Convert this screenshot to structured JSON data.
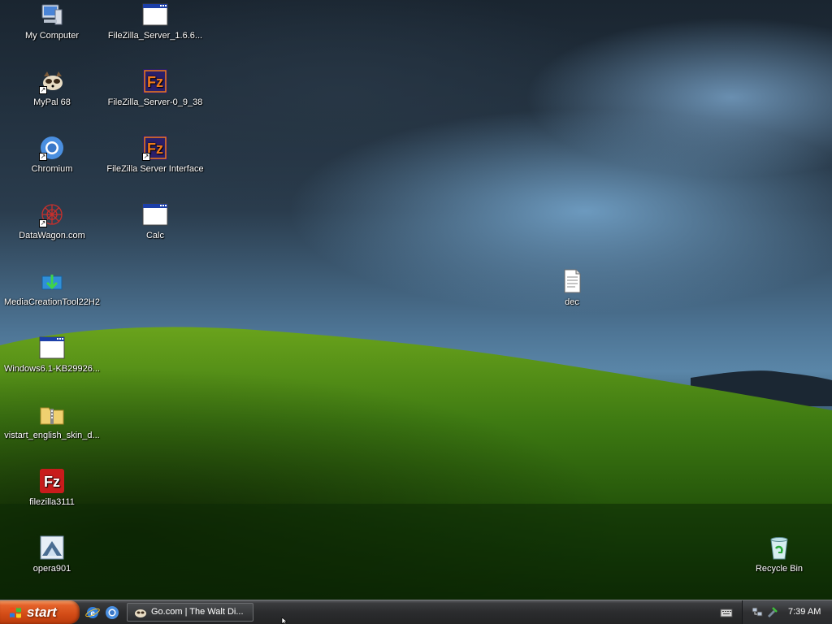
{
  "desktop": {
    "icons": [
      {
        "label": "My Computer",
        "icon": "my-computer-icon"
      },
      {
        "label": "MyPal 68",
        "icon": "mypal-icon",
        "shortcut": true
      },
      {
        "label": "Chromium",
        "icon": "chromium-icon",
        "shortcut": true
      },
      {
        "label": "DataWagon.com",
        "icon": "datawagon-icon",
        "shortcut": true
      },
      {
        "label": "MediaCreationTool22H2",
        "icon": "media-creation-tool-icon"
      },
      {
        "label": "Windows6.1-KB29926...",
        "icon": "application-window-icon"
      },
      {
        "label": "vistart_english_skin_d...",
        "icon": "zip-folder-icon"
      },
      {
        "label": "filezilla3111",
        "icon": "filezilla-icon"
      },
      {
        "label": "opera901",
        "icon": "opera-installer-icon"
      },
      {
        "label": "FileZilla_Server_1.6.6...",
        "icon": "application-window-icon"
      },
      {
        "label": "FileZilla_Server-0_9_38",
        "icon": "filezilla-server-icon"
      },
      {
        "label": "FileZilla Server Interface",
        "icon": "filezilla-server-icon",
        "shortcut": true
      },
      {
        "label": "Calc",
        "icon": "application-window-icon"
      },
      {
        "label": "dec",
        "icon": "text-document-icon"
      },
      {
        "label": "Recycle Bin",
        "icon": "recycle-bin-icon"
      }
    ]
  },
  "taskbar": {
    "start_label": "start",
    "quick_launch": [
      "internet-explorer-icon",
      "chromium-icon"
    ],
    "task_item": {
      "label": "Go.com | The Walt Di...",
      "icon": "mypal-icon"
    },
    "tray": {
      "icons": [
        "network-icon",
        "safely-remove-hardware-icon"
      ],
      "clock": "7:39 AM"
    }
  },
  "colors": {
    "start_button": "#d24b16",
    "taskbar": "#2b2c2e",
    "icon_text": "#ffffff"
  }
}
